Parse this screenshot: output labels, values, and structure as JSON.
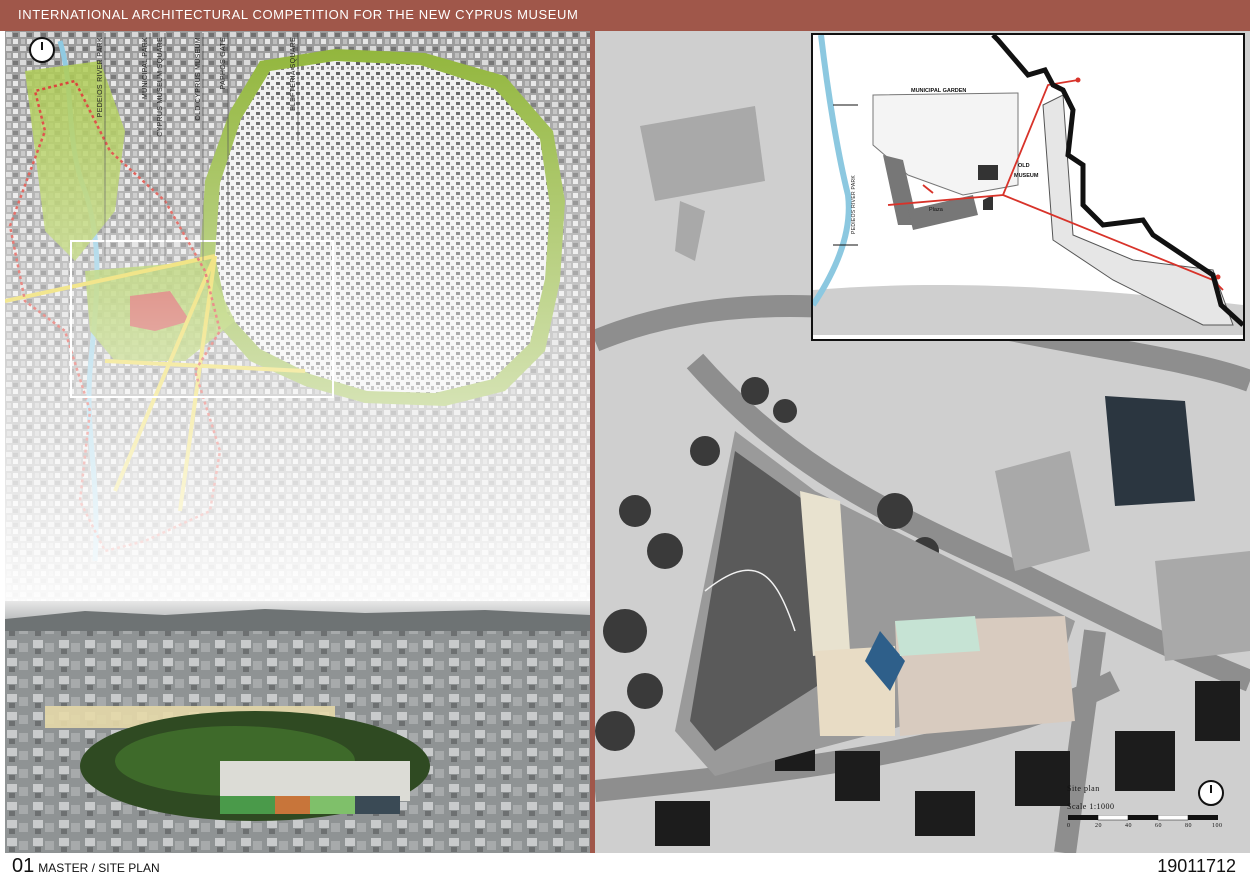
{
  "header": {
    "title": "INTERNATIONAL ARCHITECTURAL COMPETITION FOR THE NEW CYPRUS MUSEUM"
  },
  "master_map": {
    "street_labels": [
      "PEDEIOS RIVER PARK",
      "MUNICIPAL PARK",
      "CYPRUS MUSEUM SQUARE",
      "OLD CYPRUS MUSEUM",
      "PAPHOS GATE",
      "ELEFTERIA SQUARE"
    ]
  },
  "inset": {
    "labels": {
      "garden": "MUNICIPAL GARDEN",
      "old_museum_1": "OLD",
      "old_museum_2": "MUSEUM",
      "river": "PEDIEOS RIVER PARK",
      "plaza": "Plaza"
    }
  },
  "site_plan": {
    "title": "Site plan",
    "scale": "Scale 1:1000",
    "scale_ticks": [
      "0",
      "20",
      "40",
      "60",
      "80",
      "100"
    ]
  },
  "footer": {
    "number": "01",
    "label": "MASTER / SITE PLAN",
    "code": "19011712"
  },
  "colors": {
    "header": "#a0574a",
    "green": "#9cc23a",
    "yellow": "#e8d33a",
    "red": "#d8332a",
    "river": "#8cc8e0"
  }
}
